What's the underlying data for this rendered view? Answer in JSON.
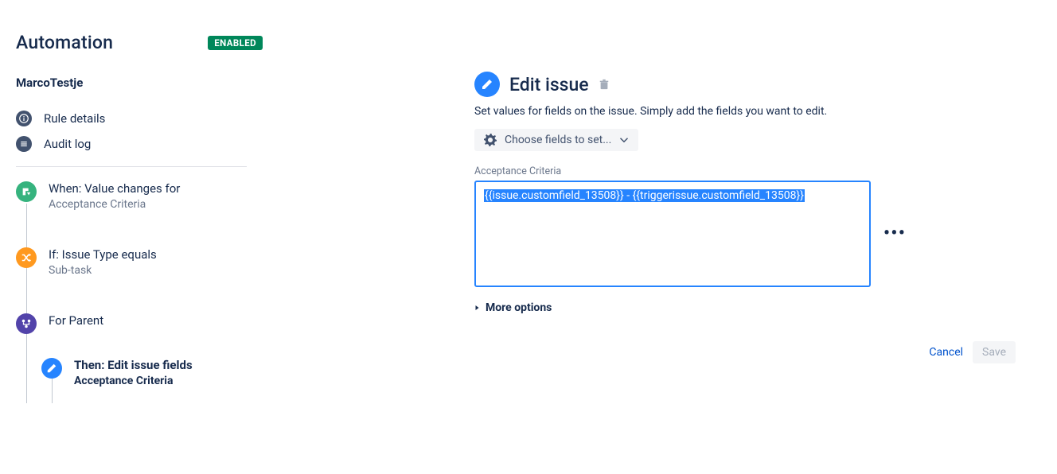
{
  "header": {
    "title": "Automation",
    "badge": "ENABLED"
  },
  "rule_name": "MarcoTestje",
  "nav": {
    "rule_details": "Rule details",
    "audit_log": "Audit log"
  },
  "chain": {
    "trigger": {
      "title": "When: Value changes for",
      "sub": "Acceptance Criteria"
    },
    "condition": {
      "title": "If: Issue Type equals",
      "sub": "Sub-task"
    },
    "branch": {
      "title": "For Parent"
    },
    "action": {
      "title": "Then: Edit issue fields",
      "sub": "Acceptance Criteria"
    }
  },
  "detail": {
    "title": "Edit issue",
    "desc": "Set values for fields on the issue. Simply add the fields you want to edit.",
    "choose_fields": "Choose fields to set...",
    "field_label": "Acceptance Criteria",
    "field_value": "{{issue.customfield_13508}} - {{triggerissue.customfield_13508}}",
    "more_options": "More options",
    "cancel": "Cancel",
    "save": "Save"
  }
}
